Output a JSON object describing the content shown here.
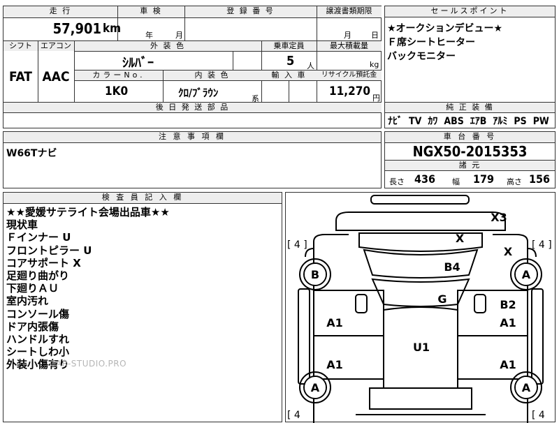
{
  "main_table": {
    "mileage": {
      "header": "走 行",
      "value": "57,901",
      "unit": "km"
    },
    "inspection": {
      "header": "車 検",
      "year": "年",
      "month": "月"
    },
    "registration": {
      "header": "登 録 番 号"
    },
    "transfer_deadline": {
      "header": "譲渡書類期限",
      "month": "月",
      "day": "日"
    },
    "shift": {
      "header": "シフト",
      "value": "FAT"
    },
    "aircon": {
      "header": "エアコン",
      "value": "AAC"
    },
    "exterior_color": {
      "header": "外 装 色",
      "value": "ｼﾙﾊﾞｰ"
    },
    "capacity": {
      "header": "乗車定員",
      "value": "5",
      "unit": "人"
    },
    "max_load": {
      "header": "最大積載量",
      "unit": "kg"
    },
    "color_no": {
      "header": "カラーNo.",
      "value": "1K0"
    },
    "interior_color": {
      "header": "内 装 色",
      "value": "ｸﾛ/ﾌﾞﾗｳﾝ",
      "suffix": "系"
    },
    "import_car": {
      "header": "輸 入 車"
    },
    "recycle": {
      "header": "リサイクル預託金",
      "value": "11,270",
      "unit": "円"
    },
    "later_parts": {
      "header": "後 日 発 送 部 品"
    }
  },
  "sales_points": {
    "header": "セールスポイント",
    "lines": [
      "★オークションデビュー★",
      "Ｆ席シートヒーター",
      "バックモニター"
    ]
  },
  "equipment": {
    "header": "純 正 装 備",
    "items": [
      "ﾅﾋﾞ",
      "TV",
      "ｶﾜ",
      "ABS",
      "ｴｱB",
      "ｱﾙﾐ",
      "PS",
      "PW"
    ]
  },
  "notes": {
    "header": "注 意 事 項 欄",
    "text": "W66Tナビ"
  },
  "chassis": {
    "header": "車 台 番 号",
    "value": "NGX50-2015353"
  },
  "specs": {
    "header": "諸 元",
    "length_label": "長さ",
    "length": "436",
    "width_label": "幅",
    "width": "179",
    "height_label": "高さ",
    "height": "156"
  },
  "inspector": {
    "header": "検 査 員 記 入 欄",
    "lines": [
      "★★愛媛サテライト会場出品車★★",
      "現状車",
      "Ｆインナー U",
      "フロントピラー U",
      "コアサポート X",
      "足廻り曲がり",
      "下廻りＡＵ",
      "室内汚れ",
      "コンソール傷",
      "ドア内張傷",
      "ハンドルすれ",
      "シートしわ小",
      "外装小傷有り"
    ],
    "watermark": "CAR-STUDIO.PRO"
  },
  "diagram": {
    "marks": {
      "x3": "X3",
      "x_hood": "X",
      "x_right": "X",
      "b4": "B4",
      "g": "G",
      "b2": "B2",
      "a1_left_front": "A1",
      "a1_right_front": "A1",
      "u1": "U1",
      "a1_left_rear": "A1",
      "a1_right_rear": "A1",
      "tire_fl": "B",
      "tire_fr": "A",
      "tire_rl": "A",
      "tire_rr": "A"
    },
    "tread": {
      "fl": "[ 4 ]",
      "fr": "[ 4 ]",
      "rl": "[ 4",
      "rr": "[ 4"
    }
  }
}
